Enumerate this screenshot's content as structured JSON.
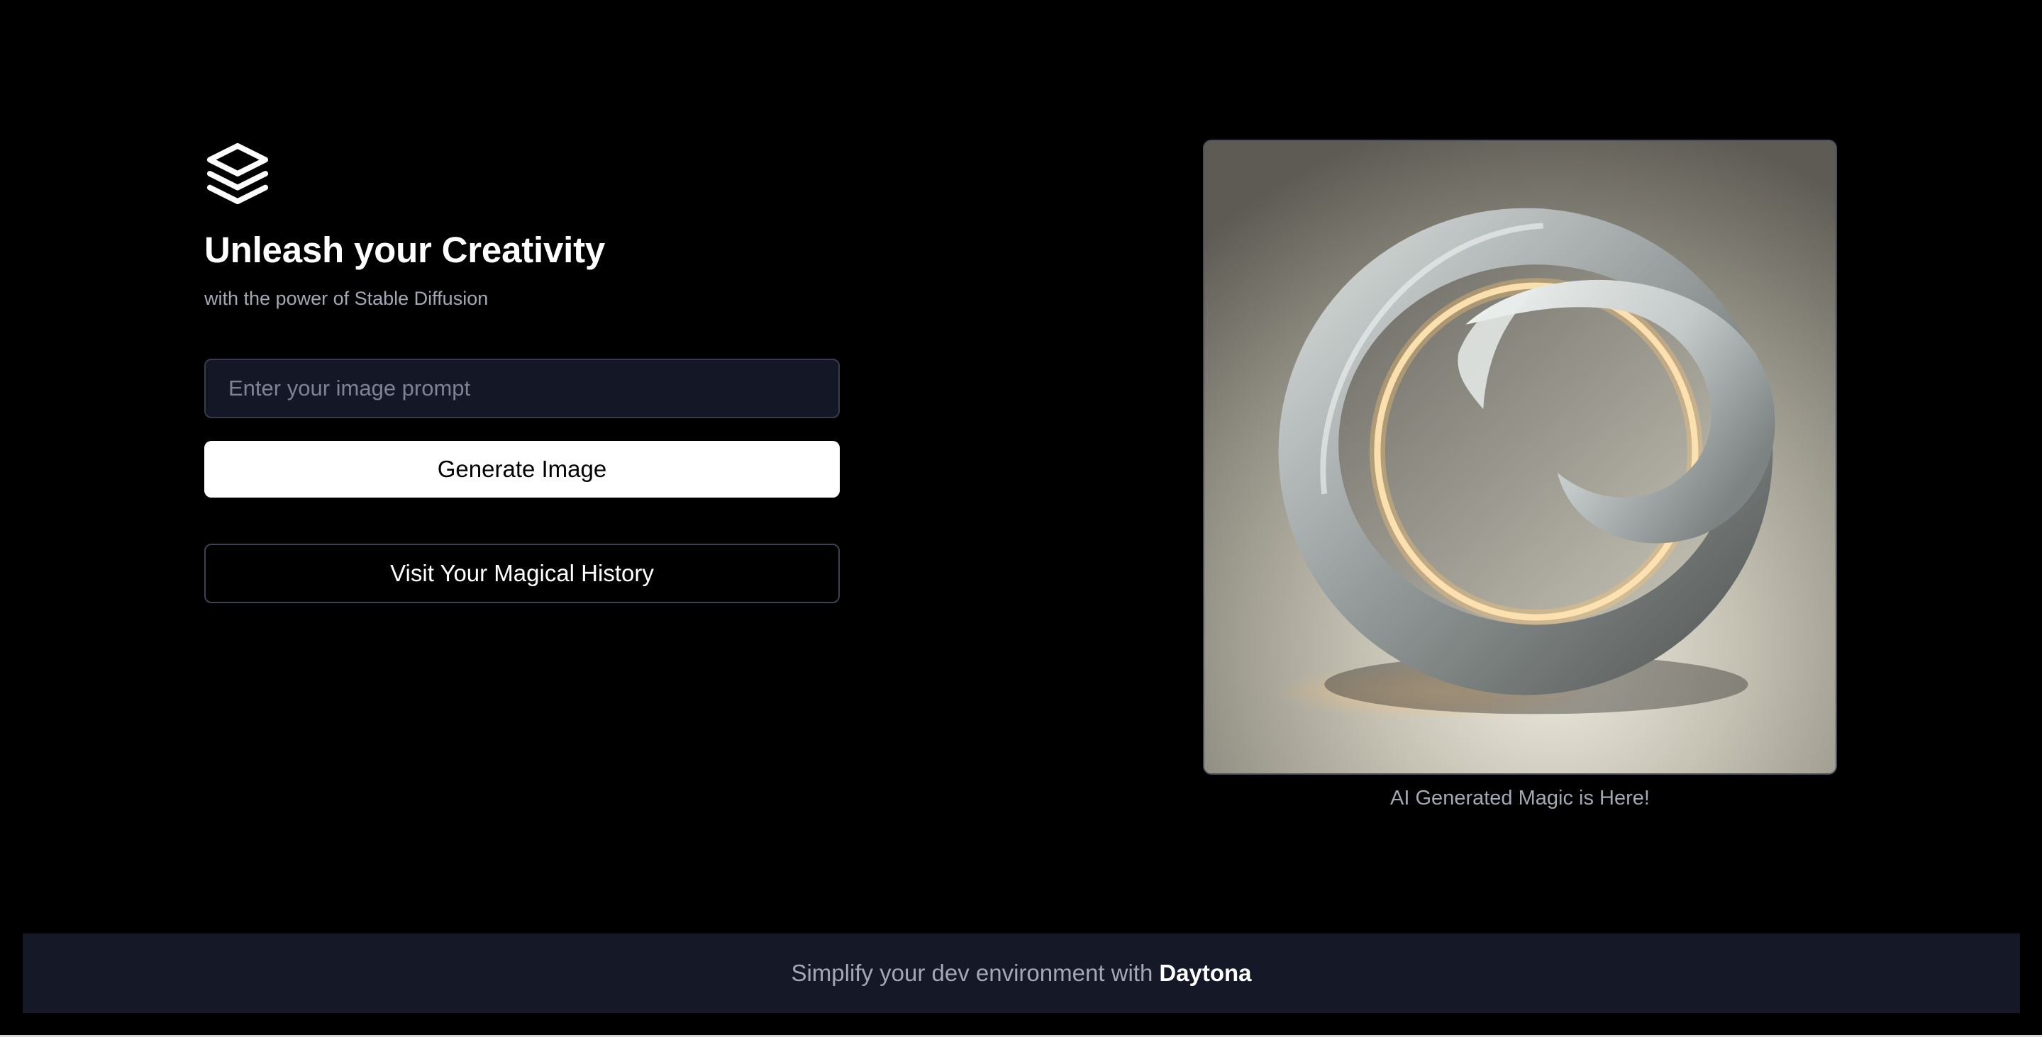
{
  "hero": {
    "logo_icon": "layers-icon",
    "title": "Unleash your Creativity",
    "subtitle": "with the power of Stable Diffusion"
  },
  "form": {
    "prompt_placeholder": "Enter your image prompt",
    "prompt_value": "",
    "generate_label": "Generate Image",
    "history_label": "Visit Your Magical History"
  },
  "preview": {
    "image_description_icon": "generated-image",
    "caption": "AI Generated Magic is Here!"
  },
  "footer": {
    "text": "Simplify your dev environment with",
    "brand": "Daytona"
  },
  "colors": {
    "background": "#000000",
    "input_bg": "#131726",
    "footer_bg": "#141827",
    "muted_text": "#a3a8b5",
    "button_bg": "#ffffff"
  }
}
